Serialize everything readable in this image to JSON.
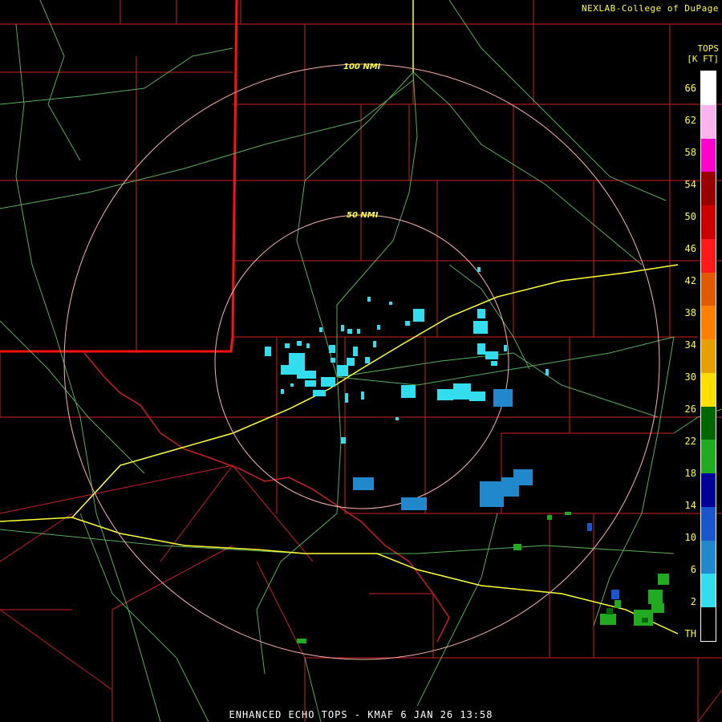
{
  "header": {
    "credit": "NEXLAB-College of DuPage"
  },
  "legend": {
    "title_line1": "TOPS",
    "title_line2": "[K FT]",
    "ticks": [
      "66",
      "62",
      "58",
      "54",
      "50",
      "46",
      "42",
      "38",
      "34",
      "30",
      "26",
      "22",
      "18",
      "14",
      "10",
      "6",
      "2",
      "TH"
    ],
    "colors": [
      "#ffffff",
      "#ffb3ec",
      "#ff00cc",
      "#990000",
      "#cc0000",
      "#ff1a1a",
      "#e05a00",
      "#ff8000",
      "#e6a000",
      "#ffdd00",
      "#006600",
      "#22aa22",
      "#000099",
      "#1a55cc",
      "#2288cc",
      "#33ddee",
      "#000000"
    ]
  },
  "range_rings": {
    "inner_label": "50 NMI",
    "outer_label": "100 NMI"
  },
  "footer": {
    "caption": "ENHANCED ECHO TOPS - KMAF 6 JAN 26 13:58"
  }
}
